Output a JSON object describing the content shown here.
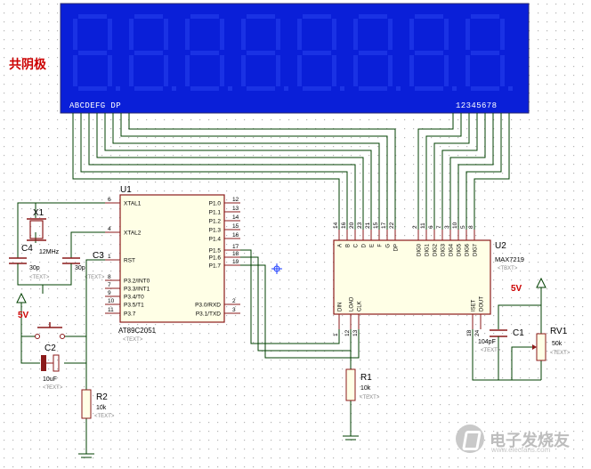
{
  "heading": "共阴极",
  "lcd": {
    "segment_labels": "ABCDEFG DP",
    "digit_labels": "12345678"
  },
  "mcu": {
    "ref": "U1",
    "part": "AT89C2051",
    "text": "<TEXT>",
    "left_pins": [
      {
        "num": "6",
        "name": "XTAL1"
      },
      {
        "num": "4",
        "name": "XTAL2"
      },
      {
        "num": "1",
        "name": "RST"
      },
      {
        "num": "8",
        "name": "P3.2/INT0"
      },
      {
        "num": "7",
        "name": "P3.3/INT1"
      },
      {
        "num": "9",
        "name": "P3.4/T0"
      },
      {
        "num": "10",
        "name": "P3.5/T1"
      },
      {
        "num": "11",
        "name": "P3.7"
      }
    ],
    "right_pins": [
      {
        "num": "12",
        "name": "P1.0"
      },
      {
        "num": "13",
        "name": "P1.1"
      },
      {
        "num": "14",
        "name": "P1.2"
      },
      {
        "num": "15",
        "name": "P1.3"
      },
      {
        "num": "16",
        "name": "P1.4"
      },
      {
        "num": "17",
        "name": "P1.5"
      },
      {
        "num": "18",
        "name": "P1.6"
      },
      {
        "num": "19",
        "name": "P1.7"
      },
      {
        "num": "2",
        "name": "P3.0/RXD"
      },
      {
        "num": "3",
        "name": "P3.1/TXD"
      }
    ]
  },
  "max": {
    "ref": "U2",
    "part": "MAX7219",
    "text": "<TBXT>",
    "top_pins": [
      {
        "num": "14",
        "name": "A"
      },
      {
        "num": "16",
        "name": "B"
      },
      {
        "num": "20",
        "name": "C"
      },
      {
        "num": "23",
        "name": "D"
      },
      {
        "num": "21",
        "name": "E"
      },
      {
        "num": "15",
        "name": "F"
      },
      {
        "num": "17",
        "name": "G"
      },
      {
        "num": "22",
        "name": "DP"
      },
      {
        "num": "2",
        "name": "DIG0"
      },
      {
        "num": "11",
        "name": "DIG1"
      },
      {
        "num": "6",
        "name": "DIG2"
      },
      {
        "num": "7",
        "name": "DIG3"
      },
      {
        "num": "3",
        "name": "DIG4"
      },
      {
        "num": "10",
        "name": "DIG5"
      },
      {
        "num": "5",
        "name": "DIG6"
      },
      {
        "num": "8",
        "name": "DIG7"
      }
    ],
    "bottom_pins": [
      {
        "num": "1",
        "name": "DIN"
      },
      {
        "num": "12",
        "name": "LOAD"
      },
      {
        "num": "13",
        "name": "CLK"
      },
      {
        "num": "18",
        "name": "ISET"
      },
      {
        "num": "24",
        "name": "DOUT"
      }
    ]
  },
  "parts": {
    "x1": {
      "ref": "X1",
      "value": "12MHz"
    },
    "c4": {
      "ref": "C4",
      "value": "30p",
      "text": "<TEXT>"
    },
    "c3": {
      "ref": "C3",
      "value": "30p",
      "text": "<TEXT>"
    },
    "c2": {
      "ref": "C2",
      "value": "10uF",
      "text": "<TEXT>"
    },
    "r2": {
      "ref": "R2",
      "value": "10k",
      "text": "<TEXT>"
    },
    "r1": {
      "ref": "R1",
      "value": "10k",
      "text": "<TEXT>"
    },
    "c1": {
      "ref": "C1",
      "value": "104pF",
      "text": "<TEXT>"
    },
    "rv1": {
      "ref": "RV1",
      "value": "50k",
      "text": "<TEXT>"
    },
    "u1_small_text": "<TEXT>"
  },
  "power": {
    "left": "5V",
    "right": "5V"
  },
  "watermark": {
    "text": "电子发烧友",
    "sub": "www.elecfans.com"
  },
  "colors": {
    "wire": "#004000",
    "body": "#8b1a1a",
    "lcd_bg": "#0a1fd8",
    "lcd_seg": "#1c34e6",
    "label": "#cc0000",
    "pin": "#8b1a1a",
    "grid": "#b5b5b5"
  }
}
